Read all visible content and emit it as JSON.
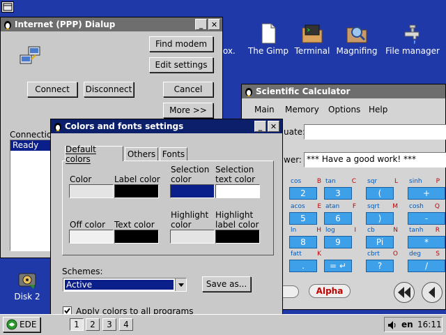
{
  "desktop": {
    "icons": [
      {
        "name": "partial-icon-label",
        "label": "nox."
      },
      {
        "name": "the-gimp",
        "label": "The Gimp"
      },
      {
        "name": "terminal",
        "label": "Terminal"
      },
      {
        "name": "magnifing",
        "label": "Magnifing"
      },
      {
        "name": "file-manager",
        "label": "File manager"
      },
      {
        "name": "disk-2",
        "label": "Disk 2"
      }
    ]
  },
  "dialup": {
    "title": "Internet (PPP) Dialup",
    "find_modem": "Find modem",
    "edit_settings": "Edit settings",
    "connect": "Connect",
    "disconnect": "Disconnect",
    "cancel": "Cancel",
    "more": "More >>",
    "connection_label": "Connectio",
    "status_item": "Ready"
  },
  "calculator": {
    "title": "Scientific Calculator",
    "menu": [
      "Main",
      "Memory",
      "Options",
      "Help"
    ],
    "evaluate_label": "uate:",
    "answer_label": "wer:",
    "answer_value": "*** Have a good work! ***",
    "keys": [
      {
        "fn": "cos",
        "key": "B",
        "face": "2"
      },
      {
        "fn": "tan",
        "key": "C",
        "face": "3"
      },
      {
        "fn": "sqr",
        "key": "L",
        "face": "("
      },
      {
        "fn": "sinh",
        "key": "P",
        "face": "+"
      },
      {
        "fn": "acos",
        "key": "E",
        "face": "5"
      },
      {
        "fn": "atan",
        "key": "F",
        "face": "6"
      },
      {
        "fn": "sqrt",
        "key": "M",
        "face": ")"
      },
      {
        "fn": "cosh",
        "key": "Q",
        "face": "-"
      },
      {
        "fn": "ln",
        "key": "H",
        "face": "8"
      },
      {
        "fn": "log",
        "key": "I",
        "face": "9"
      },
      {
        "fn": "cb",
        "key": "N",
        "face": "Pi"
      },
      {
        "fn": "tanh",
        "key": "R",
        "face": "*"
      },
      {
        "fn": "fatt",
        "key": "K",
        "face": "."
      },
      {
        "fn": "",
        "key": "",
        "face": "= ↵"
      },
      {
        "fn": "cbrt",
        "key": "O",
        "face": "?"
      },
      {
        "fn": "deg",
        "key": "S",
        "face": "/"
      }
    ],
    "alpha": "Alpha"
  },
  "colors_dialog": {
    "title": "Colors and fonts settings",
    "tabs": [
      "Default colors",
      "Others",
      "Fonts"
    ],
    "labels": {
      "color": "Color",
      "label_color": "Label color",
      "selection_color": "Selection color",
      "selection_text_color": "Selection text color",
      "off_color": "Off color",
      "text_color": "Text color",
      "highlight_color": "Highlight color",
      "highlight_label_color": "Highlight label color"
    },
    "swatches": {
      "color": "#e4e4e4",
      "label_color": "#000000",
      "selection_color": "#0b1f8a",
      "selection_text_color": "#ffffff",
      "off_color": "#f0f0f0",
      "text_color": "#000000",
      "highlight_color": "#e4e4e4",
      "highlight_label_color": "#000000"
    },
    "schemes_label": "Schemes:",
    "scheme_value": "Active",
    "save_as": "Save as...",
    "apply_all": "Apply colors to all programs"
  },
  "taskbar": {
    "start": "EDE",
    "workspaces": [
      "1",
      "2",
      "3",
      "4"
    ],
    "lang": "en",
    "clock": "16:11"
  },
  "colors": {
    "desktop": "#1f3aa8",
    "active_title": "#0b1f6b",
    "inactive_title": "#6e6e6e",
    "window": "#c9c9c9",
    "calc_button": "#3ea0e8"
  }
}
